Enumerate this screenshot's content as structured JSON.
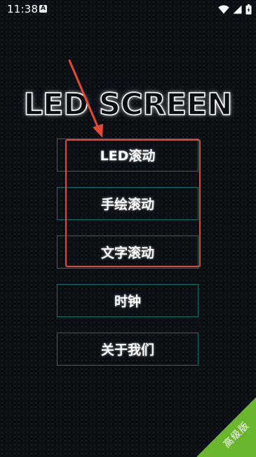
{
  "status_bar": {
    "time": "11:38",
    "notification_letter": "A"
  },
  "title": "LED SCREEN",
  "menu": [
    {
      "label": "LED滚动"
    },
    {
      "label": "手绘滚动"
    },
    {
      "label": "文字滚动"
    },
    {
      "label": "时钟"
    },
    {
      "label": "关于我们"
    }
  ],
  "badge": {
    "label": "高级版"
  },
  "colors": {
    "background": "#0b0f14",
    "button_border": "#1d6e6a",
    "annotation_red": "#e24a35",
    "badge_green": "#6ab62c"
  },
  "icons": {
    "status_left": "notification-a-icon",
    "status_right": [
      "wifi-icon",
      "signal-icon",
      "battery-charging-icon"
    ]
  }
}
